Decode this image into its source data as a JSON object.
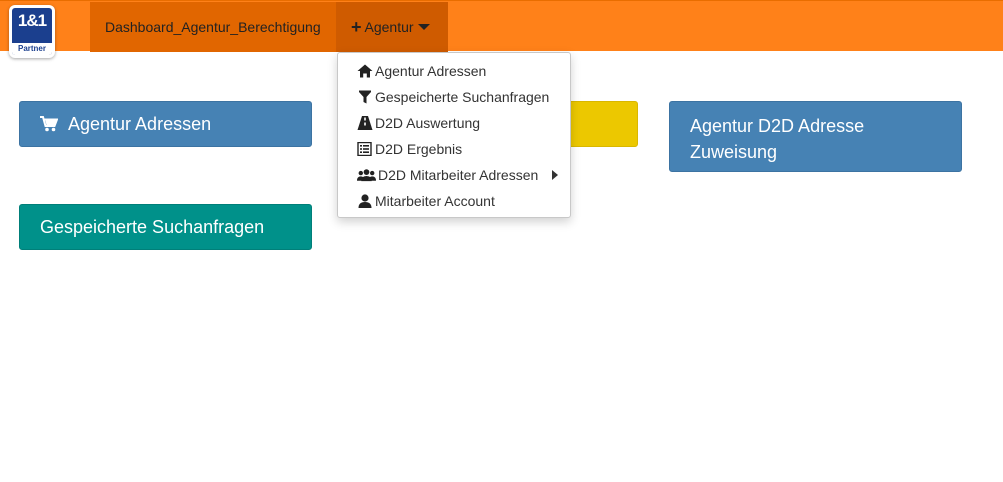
{
  "logo": {
    "brand": "1&1",
    "sub": "Partner"
  },
  "nav": {
    "dashboard": "Dashboard_Agentur_Berechtigung",
    "agentur": "Agentur"
  },
  "dropdown": {
    "items": [
      {
        "label": "Agentur Adressen",
        "icon": "home-icon"
      },
      {
        "label": "Gespeicherte Suchanfragen",
        "icon": "filter-icon"
      },
      {
        "label": "D2D Auswertung",
        "icon": "road-icon"
      },
      {
        "label": "D2D Ergebnis",
        "icon": "list-icon"
      },
      {
        "label": "D2D Mitarbeiter Adressen",
        "icon": "users-icon",
        "submenu": true
      },
      {
        "label": "Mitarbeiter Account",
        "icon": "user-icon"
      }
    ]
  },
  "tiles": {
    "adressen": "Agentur Adressen",
    "d2d": "Agentur D2D Adresse Zuweisung",
    "gespeicherte": "Gespeicherte Suchanfragen"
  },
  "colors": {
    "navbar": "#ff8119",
    "nav_active": "#cf5b00",
    "tile_blue": "#4682b4",
    "tile_yellow": "#ecc800",
    "tile_teal": "#00918a"
  }
}
